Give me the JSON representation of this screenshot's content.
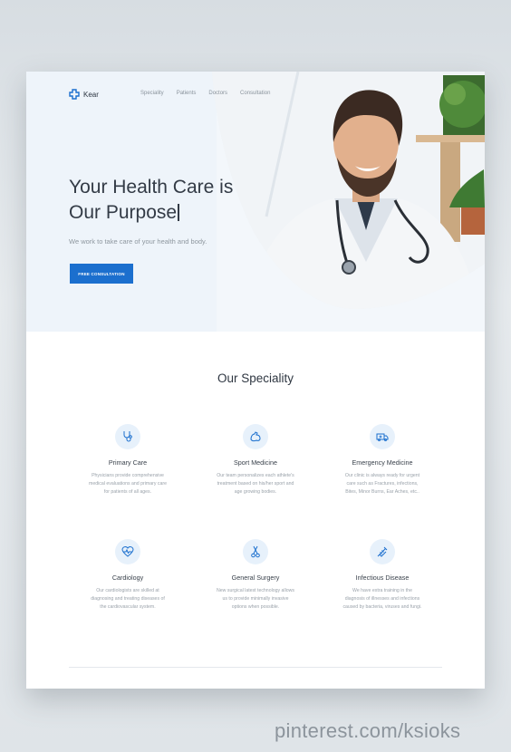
{
  "brand": {
    "name": "Kear"
  },
  "nav": {
    "items": [
      "Speciality",
      "Patients",
      "Doctors",
      "Consultation"
    ]
  },
  "hero": {
    "title_line1": "Your Health Care is",
    "title_line2": "Our Purpose",
    "subtitle": "We work to take care of your health and body.",
    "cta": "FREE CONSULTATION"
  },
  "speciality": {
    "title": "Our Speciality",
    "items": [
      {
        "icon": "stethoscope-icon",
        "title": "Primary Care",
        "desc": [
          "Physicians provide comprehensive",
          "medical evaluations and primary care",
          "for patients of all ages."
        ]
      },
      {
        "icon": "arm-muscle-icon",
        "title": "Sport Medicine",
        "desc": [
          "Our team personalizes each athlete's",
          "treatment based on his/her sport and",
          "age growing bodies."
        ]
      },
      {
        "icon": "ambulance-icon",
        "title": "Emergency Medicine",
        "desc": [
          "Our clinic is always ready for urgent",
          "care such as Fractures, infections,",
          "Bites, Minor Burns, Ear Aches, etc.."
        ]
      },
      {
        "icon": "heart-pulse-icon",
        "title": "Cardiology",
        "desc": [
          "Our cardiologists are skilled at",
          "diagnosing and treating diseases of",
          "the cardiovascular system."
        ]
      },
      {
        "icon": "scissors-icon",
        "title": "General Surgery",
        "desc": [
          "New surgical latest technology allows",
          "us to provide minimally invasive",
          "options when possible."
        ]
      },
      {
        "icon": "syringe-icon",
        "title": "Infectious Disease",
        "desc": [
          "We have extra training in the",
          "diagnosis of illnesses and infections",
          "caused by bacteria, viruses and fungi."
        ]
      }
    ]
  },
  "watermark": "pinterest.com/ksioks",
  "colors": {
    "accent": "#1b6fce",
    "hero_bg": "#eef4fa",
    "icon_bg": "#e7f1fb"
  }
}
